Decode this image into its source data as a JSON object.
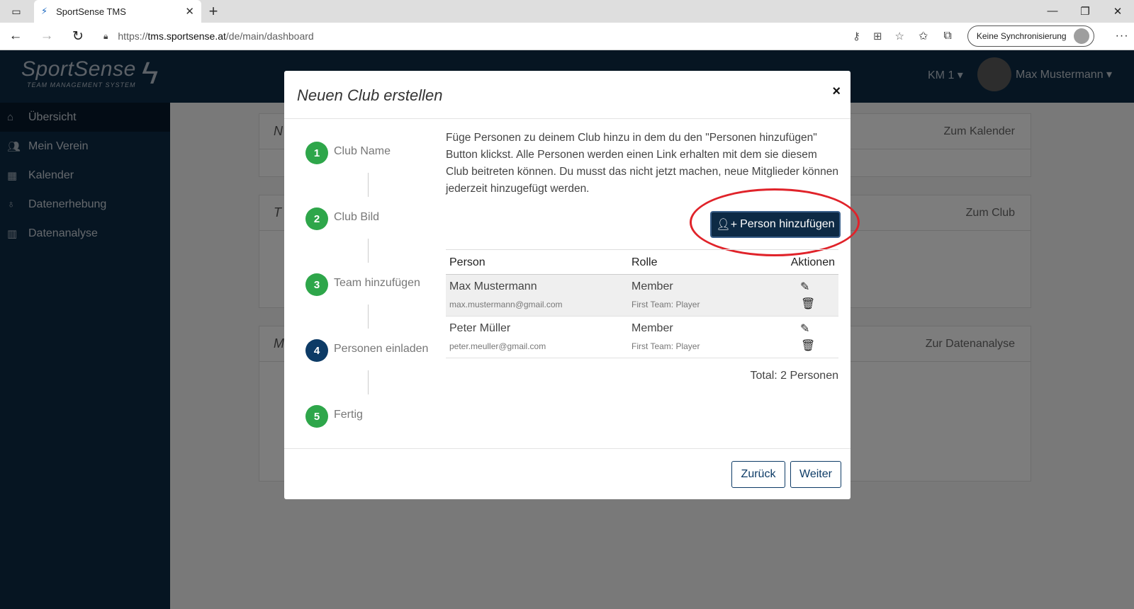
{
  "browser": {
    "tab_title": "SportSense TMS",
    "tab_close": "✕",
    "new_tab": "+",
    "url_scheme": "https://",
    "url_host": "tms.sportsense.at",
    "url_path": "/de/main/dashboard",
    "sync_label": "Keine Synchronisierung",
    "more": "···"
  },
  "app": {
    "logo_name": "SportSense",
    "logo_sub": "TEAM MANAGEMENT SYSTEM",
    "km_label": "KM 1",
    "user_name": "Max Mustermann",
    "sidebar": [
      {
        "label": "Übersicht",
        "icon": "home-icon"
      },
      {
        "label": "Mein Verein",
        "icon": "users-icon"
      },
      {
        "label": "Kalender",
        "icon": "calendar-icon"
      },
      {
        "label": "Datenerhebung",
        "icon": "stethoscope-icon"
      },
      {
        "label": "Datenanalyse",
        "icon": "chart-icon"
      }
    ],
    "cards": [
      {
        "left": "N",
        "right": "Zum Kalender"
      },
      {
        "left": "T",
        "right": "Zum Club"
      },
      {
        "left": "M",
        "right": "Zur Datenanalyse"
      }
    ]
  },
  "modal": {
    "title": "Neuen Club erstellen",
    "close": "×",
    "steps": [
      {
        "num": "1",
        "label": "Club Name"
      },
      {
        "num": "2",
        "label": "Club Bild"
      },
      {
        "num": "3",
        "label": "Team hinzufügen"
      },
      {
        "num": "4",
        "label": "Personen einladen"
      },
      {
        "num": "5",
        "label": "Fertig"
      }
    ],
    "description": "Füge Personen zu deinem Club hinzu in dem du den \"Personen hinzufügen\" Button klickst. Alle Personen werden einen Link erhalten mit dem sie diesem Club beitreten können. Du musst das nicht jetzt machen, neue Mitglieder können jederzeit hinzugefügt werden.",
    "add_button": "Person hinzufügen",
    "table": {
      "headers": [
        "Person",
        "Rolle",
        "Aktionen"
      ],
      "rows": [
        {
          "name": "Max Mustermann",
          "email": "max.mustermann@gmail.com",
          "role": "Member",
          "team": "First Team: Player"
        },
        {
          "name": "Peter Müller",
          "email": "peter.meuller@gmail.com",
          "role": "Member",
          "team": "First Team: Player"
        }
      ]
    },
    "total": "Total: 2 Personen",
    "back_button": "Zurück",
    "next_button": "Weiter"
  }
}
